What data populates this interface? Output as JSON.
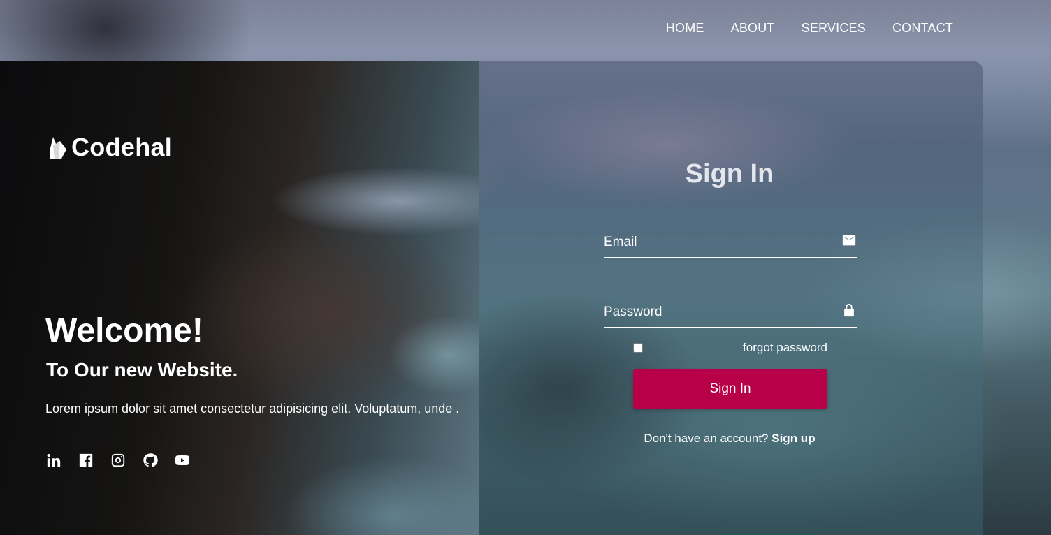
{
  "nav": {
    "items": [
      {
        "label": "HOME"
      },
      {
        "label": "ABOUT"
      },
      {
        "label": "SERVICES"
      },
      {
        "label": "CONTACT"
      }
    ]
  },
  "brand": {
    "name": "Codehal",
    "icon": "fire-logo-icon"
  },
  "hero": {
    "title": "Welcome!",
    "subtitle": "To Our new Website.",
    "description": "Lorem ipsum dolor sit amet consectetur adipisicing elit. Voluptatum, unde ."
  },
  "socials": [
    {
      "icon": "linkedin-icon"
    },
    {
      "icon": "facebook-icon"
    },
    {
      "icon": "instagram-icon"
    },
    {
      "icon": "github-icon"
    },
    {
      "icon": "youtube-icon"
    }
  ],
  "form": {
    "title": "Sign In",
    "email_placeholder": "Email",
    "password_placeholder": "Password",
    "forgot_label": "forgot password",
    "submit_label": "Sign In",
    "signup_prompt": "Don't have an account?",
    "signup_link": "Sign up"
  },
  "colors": {
    "accent": "#b80048"
  }
}
